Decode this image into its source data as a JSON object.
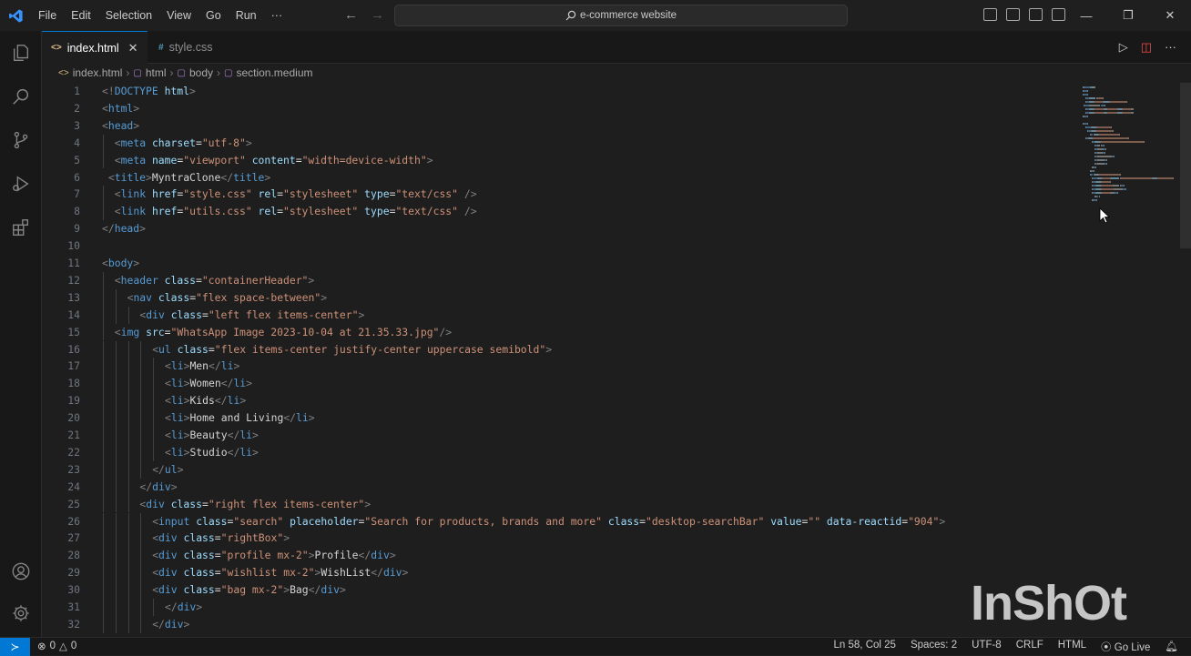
{
  "titlebar": {
    "menu": [
      "File",
      "Edit",
      "Selection",
      "View",
      "Go",
      "Run",
      "···"
    ],
    "search_text": "e-commerce website",
    "window_controls": [
      "—",
      "❐",
      "✕"
    ]
  },
  "activity_bar": {
    "items": [
      "explorer-icon",
      "search-icon",
      "source-control-icon",
      "run-debug-icon",
      "extensions-icon"
    ],
    "bottom": [
      "account-icon",
      "settings-icon"
    ]
  },
  "tabs": [
    {
      "label": "index.html",
      "icon": "<>",
      "close": "✕",
      "active": true
    },
    {
      "label": "style.css",
      "icon": "#",
      "active": false
    }
  ],
  "breadcrumb": [
    "index.html",
    "html",
    "body",
    "section.medium"
  ],
  "code": {
    "lines": [
      {
        "n": "1",
        "indent": 0,
        "tokens": [
          [
            "tag",
            "<!"
          ],
          [
            "name",
            "DOCTYPE"
          ],
          [
            "text",
            " "
          ],
          [
            "attr",
            "html"
          ],
          [
            "tag",
            ">"
          ]
        ]
      },
      {
        "n": "2",
        "indent": 0,
        "tokens": [
          [
            "tag",
            "<"
          ],
          [
            "name",
            "html"
          ],
          [
            "tag",
            ">"
          ]
        ]
      },
      {
        "n": "3",
        "indent": 0,
        "tokens": [
          [
            "tag",
            "<"
          ],
          [
            "name",
            "head"
          ],
          [
            "tag",
            ">"
          ]
        ]
      },
      {
        "n": "4",
        "indent": 2,
        "tokens": [
          [
            "tag",
            "<"
          ],
          [
            "name",
            "meta"
          ],
          [
            "text",
            " "
          ],
          [
            "attr",
            "charset"
          ],
          [
            "text",
            "="
          ],
          [
            "str",
            "\"utf-8\""
          ],
          [
            "tag",
            ">"
          ]
        ]
      },
      {
        "n": "5",
        "indent": 2,
        "tokens": [
          [
            "tag",
            "<"
          ],
          [
            "name",
            "meta"
          ],
          [
            "text",
            " "
          ],
          [
            "attr",
            "name"
          ],
          [
            "text",
            "="
          ],
          [
            "str",
            "\"viewport\""
          ],
          [
            "text",
            " "
          ],
          [
            "attr",
            "content"
          ],
          [
            "text",
            "="
          ],
          [
            "str",
            "\"width=device-width\""
          ],
          [
            "tag",
            ">"
          ]
        ]
      },
      {
        "n": "6",
        "indent": 1,
        "tokens": [
          [
            "tag",
            "<"
          ],
          [
            "name",
            "title"
          ],
          [
            "tag",
            ">"
          ],
          [
            "text",
            "MyntraClone"
          ],
          [
            "tag",
            "</"
          ],
          [
            "name",
            "title"
          ],
          [
            "tag",
            ">"
          ]
        ]
      },
      {
        "n": "7",
        "indent": 2,
        "tokens": [
          [
            "tag",
            "<"
          ],
          [
            "name",
            "link"
          ],
          [
            "text",
            " "
          ],
          [
            "attr",
            "href"
          ],
          [
            "text",
            "="
          ],
          [
            "str",
            "\"style.css\""
          ],
          [
            "text",
            " "
          ],
          [
            "attr",
            "rel"
          ],
          [
            "text",
            "="
          ],
          [
            "str",
            "\"stylesheet\""
          ],
          [
            "text",
            " "
          ],
          [
            "attr",
            "type"
          ],
          [
            "text",
            "="
          ],
          [
            "str",
            "\"text/css\""
          ],
          [
            "text",
            " "
          ],
          [
            "tag",
            "/>"
          ]
        ]
      },
      {
        "n": "8",
        "indent": 2,
        "tokens": [
          [
            "tag",
            "<"
          ],
          [
            "name",
            "link"
          ],
          [
            "text",
            " "
          ],
          [
            "attr",
            "href"
          ],
          [
            "text",
            "="
          ],
          [
            "str",
            "\"utils.css\""
          ],
          [
            "text",
            " "
          ],
          [
            "attr",
            "rel"
          ],
          [
            "text",
            "="
          ],
          [
            "str",
            "\"stylesheet\""
          ],
          [
            "text",
            " "
          ],
          [
            "attr",
            "type"
          ],
          [
            "text",
            "="
          ],
          [
            "str",
            "\"text/css\""
          ],
          [
            "text",
            " "
          ],
          [
            "tag",
            "/>"
          ]
        ]
      },
      {
        "n": "9",
        "indent": 0,
        "tokens": [
          [
            "tag",
            "</"
          ],
          [
            "name",
            "head"
          ],
          [
            "tag",
            ">"
          ]
        ]
      },
      {
        "n": "10",
        "indent": 0,
        "tokens": []
      },
      {
        "n": "11",
        "indent": 0,
        "tokens": [
          [
            "tag",
            "<"
          ],
          [
            "name",
            "body"
          ],
          [
            "tag",
            ">"
          ]
        ]
      },
      {
        "n": "12",
        "indent": 2,
        "tokens": [
          [
            "tag",
            "<"
          ],
          [
            "name",
            "header"
          ],
          [
            "text",
            " "
          ],
          [
            "attr",
            "class"
          ],
          [
            "text",
            "="
          ],
          [
            "str",
            "\"containerHeader\""
          ],
          [
            "tag",
            ">"
          ]
        ]
      },
      {
        "n": "13",
        "indent": 4,
        "tokens": [
          [
            "tag",
            "<"
          ],
          [
            "name",
            "nav"
          ],
          [
            "text",
            " "
          ],
          [
            "attr",
            "class"
          ],
          [
            "text",
            "="
          ],
          [
            "str",
            "\"flex space-between\""
          ],
          [
            "tag",
            ">"
          ]
        ]
      },
      {
        "n": "14",
        "indent": 6,
        "tokens": [
          [
            "tag",
            "<"
          ],
          [
            "name",
            "div"
          ],
          [
            "text",
            " "
          ],
          [
            "attr",
            "class"
          ],
          [
            "text",
            "="
          ],
          [
            "str",
            "\"left flex items-center\""
          ],
          [
            "tag",
            ">"
          ]
        ]
      },
      {
        "n": "15",
        "indent": 2,
        "tokens": [
          [
            "tag",
            "<"
          ],
          [
            "name",
            "img"
          ],
          [
            "text",
            " "
          ],
          [
            "attr",
            "src"
          ],
          [
            "text",
            "="
          ],
          [
            "str",
            "\"WhatsApp Image 2023-10-04 at 21.35.33.jpg\""
          ],
          [
            "tag",
            "/>"
          ]
        ]
      },
      {
        "n": "16",
        "indent": 8,
        "tokens": [
          [
            "tag",
            "<"
          ],
          [
            "name",
            "ul"
          ],
          [
            "text",
            " "
          ],
          [
            "attr",
            "class"
          ],
          [
            "text",
            "="
          ],
          [
            "str",
            "\"flex items-center justify-center uppercase semibold\""
          ],
          [
            "tag",
            ">"
          ]
        ]
      },
      {
        "n": "17",
        "indent": 10,
        "tokens": [
          [
            "tag",
            "<"
          ],
          [
            "name",
            "li"
          ],
          [
            "tag",
            ">"
          ],
          [
            "text",
            "Men"
          ],
          [
            "tag",
            "</"
          ],
          [
            "name",
            "li"
          ],
          [
            "tag",
            ">"
          ]
        ]
      },
      {
        "n": "18",
        "indent": 10,
        "tokens": [
          [
            "tag",
            "<"
          ],
          [
            "name",
            "li"
          ],
          [
            "tag",
            ">"
          ],
          [
            "text",
            "Women"
          ],
          [
            "tag",
            "</"
          ],
          [
            "name",
            "li"
          ],
          [
            "tag",
            ">"
          ]
        ]
      },
      {
        "n": "19",
        "indent": 10,
        "tokens": [
          [
            "tag",
            "<"
          ],
          [
            "name",
            "li"
          ],
          [
            "tag",
            ">"
          ],
          [
            "text",
            "Kids"
          ],
          [
            "tag",
            "</"
          ],
          [
            "name",
            "li"
          ],
          [
            "tag",
            ">"
          ]
        ]
      },
      {
        "n": "20",
        "indent": 10,
        "tokens": [
          [
            "tag",
            "<"
          ],
          [
            "name",
            "li"
          ],
          [
            "tag",
            ">"
          ],
          [
            "text",
            "Home and Living"
          ],
          [
            "tag",
            "</"
          ],
          [
            "name",
            "li"
          ],
          [
            "tag",
            ">"
          ]
        ]
      },
      {
        "n": "21",
        "indent": 10,
        "tokens": [
          [
            "tag",
            "<"
          ],
          [
            "name",
            "li"
          ],
          [
            "tag",
            ">"
          ],
          [
            "text",
            "Beauty"
          ],
          [
            "tag",
            "</"
          ],
          [
            "name",
            "li"
          ],
          [
            "tag",
            ">"
          ]
        ]
      },
      {
        "n": "22",
        "indent": 10,
        "tokens": [
          [
            "tag",
            "<"
          ],
          [
            "name",
            "li"
          ],
          [
            "tag",
            ">"
          ],
          [
            "text",
            "Studio"
          ],
          [
            "tag",
            "</"
          ],
          [
            "name",
            "li"
          ],
          [
            "tag",
            ">"
          ]
        ]
      },
      {
        "n": "23",
        "indent": 8,
        "tokens": [
          [
            "tag",
            "</"
          ],
          [
            "name",
            "ul"
          ],
          [
            "tag",
            ">"
          ]
        ]
      },
      {
        "n": "24",
        "indent": 6,
        "tokens": [
          [
            "tag",
            "</"
          ],
          [
            "name",
            "div"
          ],
          [
            "tag",
            ">"
          ]
        ]
      },
      {
        "n": "25",
        "indent": 6,
        "tokens": [
          [
            "tag",
            "<"
          ],
          [
            "name",
            "div"
          ],
          [
            "text",
            " "
          ],
          [
            "attr",
            "class"
          ],
          [
            "text",
            "="
          ],
          [
            "str",
            "\"right flex items-center\""
          ],
          [
            "tag",
            ">"
          ]
        ]
      },
      {
        "n": "26",
        "indent": 8,
        "tokens": [
          [
            "tag",
            "<"
          ],
          [
            "name",
            "input"
          ],
          [
            "text",
            " "
          ],
          [
            "attr",
            "class"
          ],
          [
            "text",
            "="
          ],
          [
            "str",
            "\"search\""
          ],
          [
            "text",
            " "
          ],
          [
            "attr",
            "placeholder"
          ],
          [
            "text",
            "="
          ],
          [
            "str",
            "\"Search for products, brands and more\""
          ],
          [
            "text",
            " "
          ],
          [
            "attr",
            "class"
          ],
          [
            "text",
            "="
          ],
          [
            "str",
            "\"desktop-searchBar\""
          ],
          [
            "text",
            " "
          ],
          [
            "attr",
            "value"
          ],
          [
            "text",
            "="
          ],
          [
            "str",
            "\"\""
          ],
          [
            "text",
            " "
          ],
          [
            "attr",
            "data-reactid"
          ],
          [
            "text",
            "="
          ],
          [
            "str",
            "\"904\""
          ],
          [
            "tag",
            ">"
          ]
        ]
      },
      {
        "n": "27",
        "indent": 8,
        "tokens": [
          [
            "tag",
            "<"
          ],
          [
            "name",
            "div"
          ],
          [
            "text",
            " "
          ],
          [
            "attr",
            "class"
          ],
          [
            "text",
            "="
          ],
          [
            "str",
            "\"rightBox\""
          ],
          [
            "tag",
            ">"
          ]
        ]
      },
      {
        "n": "28",
        "indent": 8,
        "tokens": [
          [
            "tag",
            "<"
          ],
          [
            "name",
            "div"
          ],
          [
            "text",
            " "
          ],
          [
            "attr",
            "class"
          ],
          [
            "text",
            "="
          ],
          [
            "str",
            "\"profile mx-2\""
          ],
          [
            "tag",
            ">"
          ],
          [
            "text",
            "Profile"
          ],
          [
            "tag",
            "</"
          ],
          [
            "name",
            "div"
          ],
          [
            "tag",
            ">"
          ]
        ]
      },
      {
        "n": "29",
        "indent": 8,
        "tokens": [
          [
            "tag",
            "<"
          ],
          [
            "name",
            "div"
          ],
          [
            "text",
            " "
          ],
          [
            "attr",
            "class"
          ],
          [
            "text",
            "="
          ],
          [
            "str",
            "\"wishlist mx-2\""
          ],
          [
            "tag",
            ">"
          ],
          [
            "text",
            "WishList"
          ],
          [
            "tag",
            "</"
          ],
          [
            "name",
            "div"
          ],
          [
            "tag",
            ">"
          ]
        ]
      },
      {
        "n": "30",
        "indent": 8,
        "tokens": [
          [
            "tag",
            "<"
          ],
          [
            "name",
            "div"
          ],
          [
            "text",
            " "
          ],
          [
            "attr",
            "class"
          ],
          [
            "text",
            "="
          ],
          [
            "str",
            "\"bag mx-2\""
          ],
          [
            "tag",
            ">"
          ],
          [
            "text",
            "Bag"
          ],
          [
            "tag",
            "</"
          ],
          [
            "name",
            "div"
          ],
          [
            "tag",
            ">"
          ]
        ]
      },
      {
        "n": "31",
        "indent": 10,
        "tokens": [
          [
            "tag",
            "</"
          ],
          [
            "name",
            "div"
          ],
          [
            "tag",
            ">"
          ]
        ]
      },
      {
        "n": "32",
        "indent": 8,
        "tokens": [
          [
            "tag",
            "</"
          ],
          [
            "name",
            "div"
          ],
          [
            "tag",
            ">"
          ]
        ]
      }
    ]
  },
  "statusbar": {
    "problems": "0",
    "warnings": "0",
    "position": "Ln 58, Col 25",
    "spaces": "Spaces: 2",
    "encoding": "UTF-8",
    "eol": "CRLF",
    "language": "HTML",
    "golive": "Go Live"
  },
  "watermark": "InShOt",
  "colors": {
    "accent": "#0078d4",
    "editor_bg": "#1e1e1e",
    "tag": "#808080",
    "tag_name": "#569cd6",
    "attr": "#9cdcfe",
    "string": "#ce9178"
  }
}
